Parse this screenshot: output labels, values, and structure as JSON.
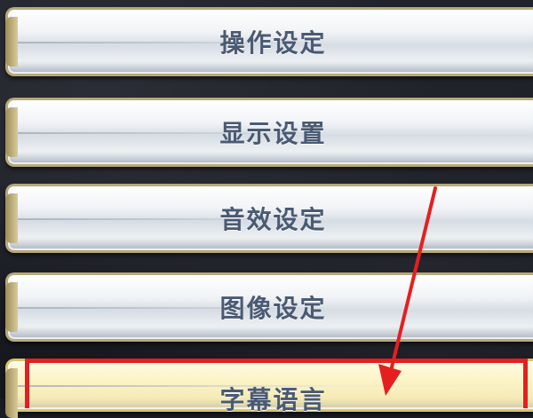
{
  "menu": {
    "items": [
      {
        "label": "操作设定"
      },
      {
        "label": "显示设置"
      },
      {
        "label": "音效设定"
      },
      {
        "label": "图像设定"
      },
      {
        "label": "字幕语言"
      }
    ],
    "selected_index": 4
  },
  "annotation": {
    "highlight_color": "#e51f1f",
    "arrow_color": "#e51f1f",
    "arrow_icon": "red-arrow-down-icon"
  }
}
